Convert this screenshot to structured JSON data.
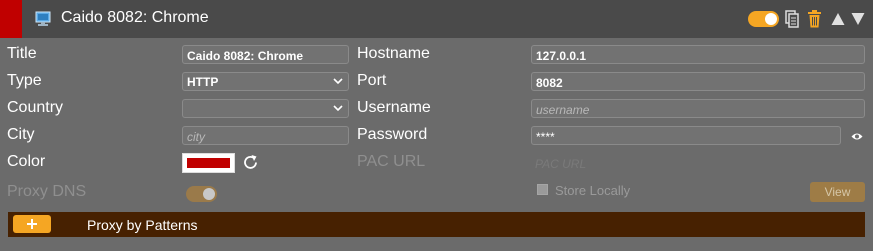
{
  "header": {
    "title": "Caido 8082: Chrome",
    "color": "#c00000",
    "icons": [
      "computer-icon",
      "toggle-switch",
      "copy-icon",
      "trash-icon",
      "move-up-icon",
      "move-down-icon"
    ],
    "enabled": true
  },
  "fields": {
    "title": {
      "label": "Title",
      "value": "Caido 8082: Chrome"
    },
    "type": {
      "label": "Type",
      "value": "HTTP"
    },
    "country": {
      "label": "Country",
      "value": ""
    },
    "city": {
      "label": "City",
      "placeholder": "city"
    },
    "color": {
      "label": "Color",
      "value": "#c00000"
    },
    "proxy_dns": {
      "label": "Proxy DNS",
      "enabled": false
    },
    "hostname": {
      "label": "Hostname",
      "value": "127.0.0.1"
    },
    "port": {
      "label": "Port",
      "value": "8082"
    },
    "username": {
      "label": "Username",
      "placeholder": "username"
    },
    "password": {
      "label": "Password",
      "value": "****"
    },
    "pac_url": {
      "label": "PAC URL",
      "placeholder": "PAC URL"
    }
  },
  "store_locally": {
    "label": "Store Locally",
    "checked": false
  },
  "view_button": {
    "label": "View"
  },
  "patterns": {
    "label": "Proxy by Patterns",
    "add_label": "+"
  },
  "colors": {
    "accent": "#f5a623",
    "header_bg": "#4a4a4a",
    "panel_bg": "#6b6b6b",
    "patterns_bg": "#472101"
  }
}
